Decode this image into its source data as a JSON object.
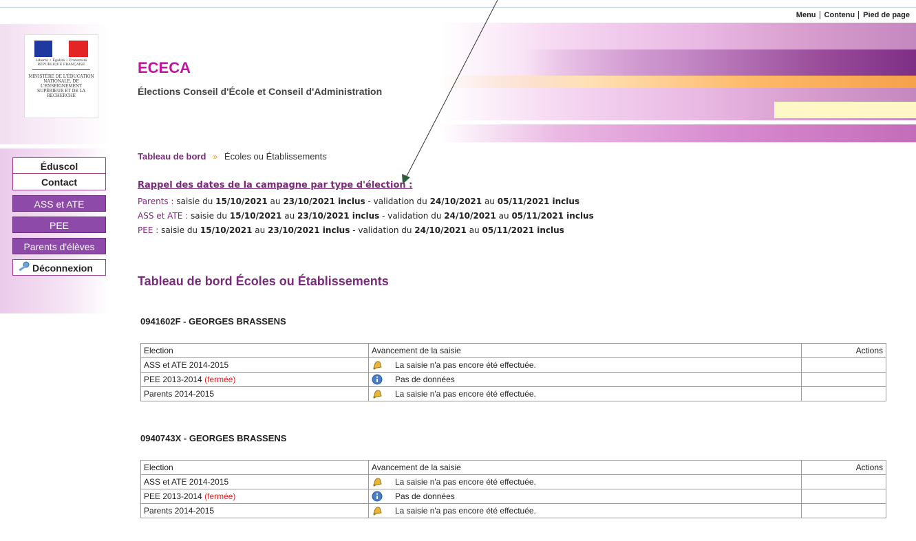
{
  "skip_links": [
    "Menu",
    "Contenu",
    "Pied de page"
  ],
  "logo": {
    "motto": "Liberté • Égalité • Fraternité RÉPUBLIQUE FRANÇAISE",
    "ministry": "MINISTÈRE DE L'ÉDUCATION NATIONALE, DE L'ENSEIGNEMENT SUPÉRIEUR ET DE LA RECHERCHE"
  },
  "header": {
    "title": "ECECA",
    "subtitle": "Élections Conseil d'École et Conseil d'Administration"
  },
  "breadcrumb": {
    "root": "Tableau de bord",
    "separator": "»",
    "current": "Écoles ou Établissements"
  },
  "campaign": {
    "heading": "Rappel des dates de la campagne par type d'élection :",
    "rows": [
      {
        "type": "Parents :",
        "pre1": "saisie du",
        "d1": "15/10/2021",
        "mid1": "au",
        "d2": "23/10/2021 inclus",
        "sep": "- validation du",
        "d3": "24/10/2021",
        "mid2": "au",
        "d4": "05/11/2021 inclus"
      },
      {
        "type": "ASS et ATE :",
        "pre1": "saisie du",
        "d1": "15/10/2021",
        "mid1": "au",
        "d2": "23/10/2021 inclus",
        "sep": "- validation du",
        "d3": "24/10/2021",
        "mid2": "au",
        "d4": "05/11/2021 inclus"
      },
      {
        "type": "PEE :",
        "pre1": "saisie du",
        "d1": "15/10/2021",
        "mid1": "au",
        "d2": "23/10/2021 inclus",
        "sep": "- validation du",
        "d3": "24/10/2021",
        "mid2": "au",
        "d4": "05/11/2021 inclus"
      }
    ]
  },
  "sidebar": {
    "items": [
      "Éduscol",
      "Contact",
      "ASS et ATE",
      "PEE",
      "Parents d'élèves",
      "Déconnexion"
    ]
  },
  "dashboard": {
    "title": "Tableau de bord Écoles ou Établissements",
    "columns": [
      "Election",
      "Avancement de la saisie",
      "Actions"
    ],
    "schools": [
      {
        "name": "0941602F - GEORGES BRASSENS",
        "rows": [
          {
            "election": "ASS et ATE 2014-2015",
            "closed": "",
            "icon": "bell-icon",
            "status": "La saisie n'a pas encore été effectuée."
          },
          {
            "election": "PEE 2013-2014",
            "closed": "(fermée)",
            "icon": "info-icon",
            "status": "Pas de données"
          },
          {
            "election": "Parents 2014-2015",
            "closed": "",
            "icon": "bell-icon",
            "status": "La saisie n'a pas encore été effectuée."
          }
        ]
      },
      {
        "name": "0940743X - GEORGES BRASSENS",
        "rows": [
          {
            "election": "ASS et ATE 2014-2015",
            "closed": "",
            "icon": "bell-icon",
            "status": "La saisie n'a pas encore été effectuée."
          },
          {
            "election": "PEE 2013-2014",
            "closed": "(fermée)",
            "icon": "info-icon",
            "status": "Pas de données"
          },
          {
            "election": "Parents 2014-2015",
            "closed": "",
            "icon": "bell-icon",
            "status": "La saisie n'a pas encore été effectuée."
          }
        ]
      }
    ]
  },
  "colors": {
    "brand": "#c4139f",
    "accent": "#7b2a7b",
    "button": "#8e4aa8",
    "closed": "#e02020"
  }
}
